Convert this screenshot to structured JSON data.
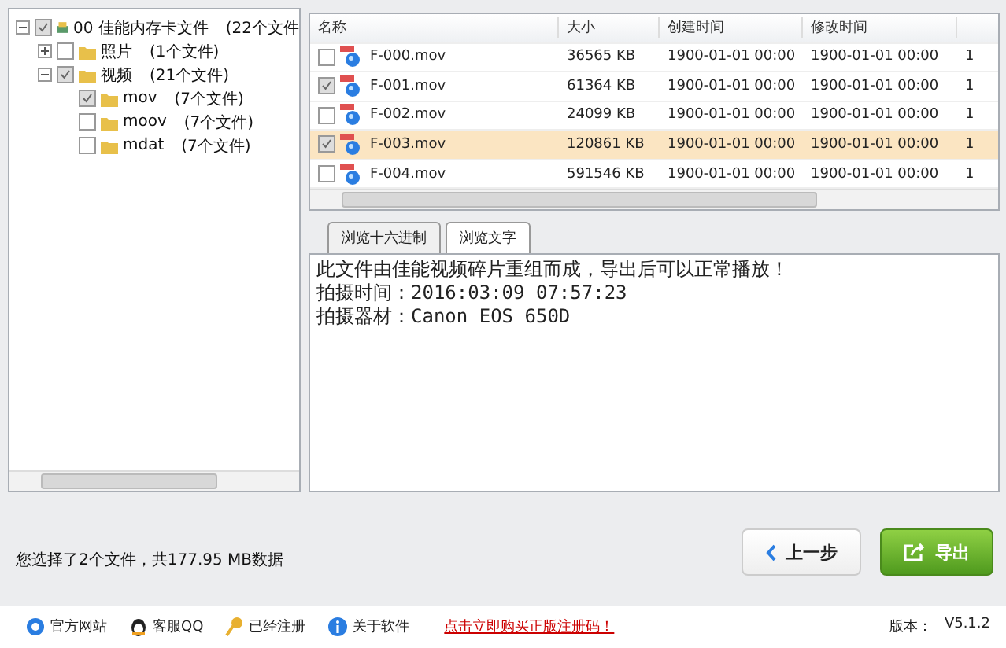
{
  "tree": [
    {
      "kind": "drive",
      "label": "00 佳能内存卡文件",
      "count": "(22个文件",
      "checked": true,
      "expanded": true,
      "children": [
        {
          "kind": "folder",
          "label": "照片",
          "count": "(1个文件)",
          "checked": false,
          "expanded": false
        },
        {
          "kind": "folder",
          "label": "视频",
          "count": "(21个文件)",
          "checked": true,
          "expanded": true,
          "children": [
            {
              "kind": "folder",
              "label": "mov",
              "count": "(7个文件)",
              "checked": true
            },
            {
              "kind": "folder",
              "label": "moov",
              "count": "(7个文件)",
              "checked": false
            },
            {
              "kind": "folder",
              "label": "mdat",
              "count": "(7个文件)",
              "checked": false
            }
          ]
        }
      ]
    }
  ],
  "table": {
    "columns": [
      "名称",
      "大小",
      "创建时间",
      "修改时间"
    ],
    "rows": [
      {
        "name": "F-000.mov",
        "size": "36565 KB",
        "created": "1900-01-01  00:00",
        "modified": "1900-01-01  00:00",
        "column_5": "1",
        "checked": false,
        "selected": false
      },
      {
        "name": "F-001.mov",
        "size": "61364 KB",
        "created": "1900-01-01  00:00",
        "modified": "1900-01-01  00:00",
        "column_5": "1",
        "checked": true,
        "selected": false
      },
      {
        "name": "F-002.mov",
        "size": "24099 KB",
        "created": "1900-01-01  00:00",
        "modified": "1900-01-01  00:00",
        "column_5": "1",
        "checked": false,
        "selected": false
      },
      {
        "name": "F-003.mov",
        "size": "120861 KB",
        "created": "1900-01-01  00:00",
        "modified": "1900-01-01  00:00",
        "column_5": "1",
        "checked": true,
        "selected": true
      },
      {
        "name": "F-004.mov",
        "size": "591546 KB",
        "created": "1900-01-01  00:00",
        "modified": "1900-01-01  00:00",
        "column_5": "1",
        "checked": false,
        "selected": false
      }
    ]
  },
  "tabs": [
    {
      "label": "浏览十六进制",
      "selected": false
    },
    {
      "label": "浏览文字",
      "selected": true
    }
  ],
  "preview_lines": [
    "此文件由佳能视频碎片重组而成，导出后可以正常播放！",
    "拍摄时间：2016:03:09 07:57:23",
    "拍摄器材：Canon EOS 650D"
  ],
  "status": "您选择了2个文件，共177.95 MB数据",
  "buttons": [
    {
      "kind": "back",
      "label": "上一步"
    },
    {
      "kind": "export",
      "label": "导出"
    }
  ],
  "footer": {
    "links": [
      {
        "kind": "ie",
        "label": "官方网站"
      },
      {
        "kind": "qq",
        "label": "客服QQ"
      },
      {
        "kind": "key",
        "label": "已经注册"
      },
      {
        "kind": "info",
        "label": "关于软件"
      }
    ],
    "promo": "点击立即购买正版注册码！",
    "version_label": "版本：",
    "version": "V5.1.2"
  }
}
